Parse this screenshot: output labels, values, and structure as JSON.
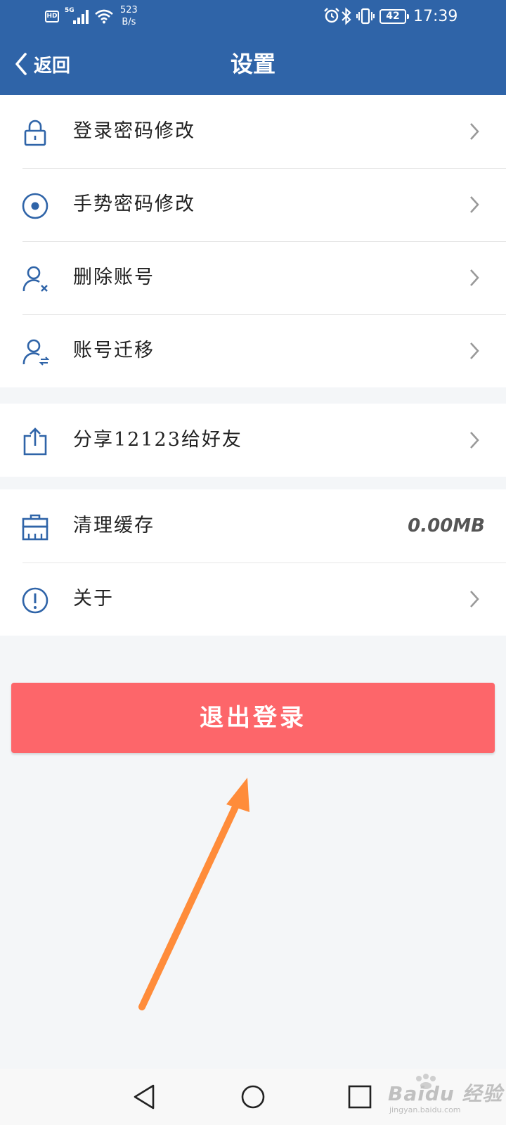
{
  "status_bar": {
    "hd": "HD",
    "network": "5G",
    "speed_value": "523",
    "speed_unit": "B/s",
    "battery": "42",
    "time": "17:39"
  },
  "header": {
    "back_label": "返回",
    "title": "设置"
  },
  "settings": {
    "group1": [
      {
        "label": "登录密码修改",
        "icon": "lock-icon"
      },
      {
        "label": "手势密码修改",
        "icon": "radio-dot-icon"
      },
      {
        "label": "删除账号",
        "icon": "user-remove-icon"
      },
      {
        "label": "账号迁移",
        "icon": "user-transfer-icon"
      }
    ],
    "group2": [
      {
        "label": "分享12123给好友",
        "icon": "share-icon"
      }
    ],
    "group3": [
      {
        "label": "清理缓存",
        "icon": "broom-icon",
        "value": "0.00MB"
      },
      {
        "label": "关于",
        "icon": "info-icon"
      }
    ]
  },
  "logout_label": "退出登录",
  "watermark": {
    "brand": "Baidu 经验",
    "url": "jingyan.baidu.com"
  },
  "colors": {
    "header": "#2f64a8",
    "icon": "#2f64a8",
    "logout": "#fd666a",
    "annotation_arrow": "#ff8c3a"
  }
}
